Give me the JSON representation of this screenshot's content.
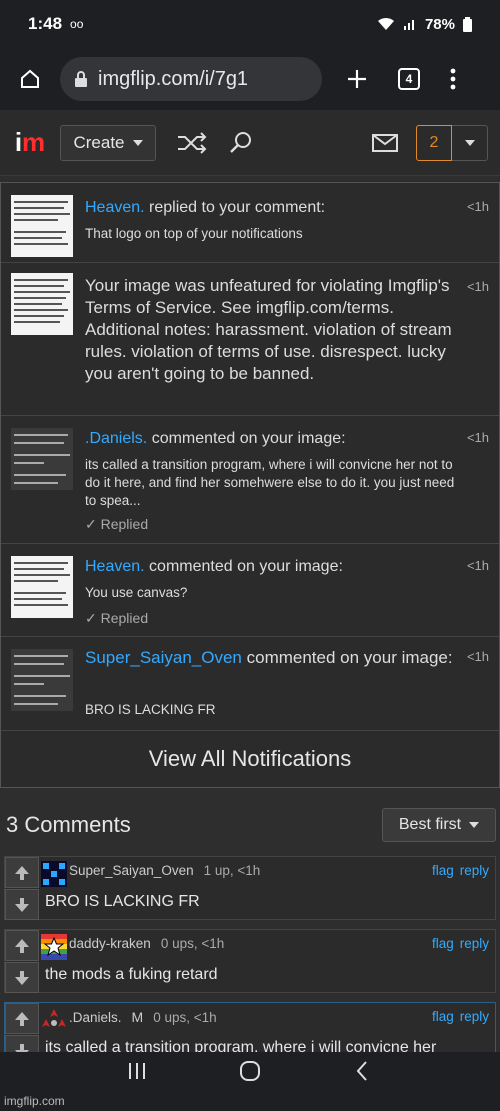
{
  "status": {
    "time": "1:48",
    "voicemail": "oo",
    "battery": "78%"
  },
  "browser": {
    "url": "imgflip.com/i/7g1",
    "tab_count": "4"
  },
  "nav": {
    "create_label": "Create",
    "notif_count": "2"
  },
  "notifications": [
    {
      "user": "Heaven.",
      "action": " replied to your comment:",
      "time": "<1h",
      "body": "That logo on top of your notifications",
      "replied": ""
    },
    {
      "user": "",
      "action": "Your image was unfeatured for violating Imgflip's Terms of Service. See imgflip.com/terms. Additional notes: harassment. violation of stream rules. violation of terms of use. disrespect. lucky you aren't going to be banned.",
      "time": "<1h",
      "body": "",
      "replied": ""
    },
    {
      "user": ".Daniels.",
      "action": " commented on your image:",
      "time": "<1h",
      "body": "its called a transition program, where i will convicne her not to do it here, and find her somehwere else to do it. you just need to spea...",
      "replied": "Replied"
    },
    {
      "user": "Heaven.",
      "action": " commented on your image:",
      "time": "<1h",
      "body": "You use canvas?",
      "replied": "Replied"
    },
    {
      "user": "Super_Saiyan_Oven",
      "action": " commented on your image:",
      "time": "<1h",
      "body": "BRO IS LACKING FR",
      "replied": ""
    }
  ],
  "view_all": "View All Notifications",
  "comments": {
    "header": "3 Comments",
    "sort": "Best first",
    "flag": "flag",
    "reply": "reply",
    "items": [
      {
        "user": "Super_Saiyan_Oven",
        "meta": "1 up, <1h",
        "text": "BRO IS LACKING FR"
      },
      {
        "user": "daddy-kraken",
        "meta": "0 ups, <1h",
        "text": "the mods a fuking retard"
      },
      {
        "user": ".Daniels.",
        "badge": "M",
        "meta": "0 ups, <1h",
        "text": "its called a transition program, where i will convicne her"
      }
    ]
  },
  "watermark": "imgflip.com"
}
